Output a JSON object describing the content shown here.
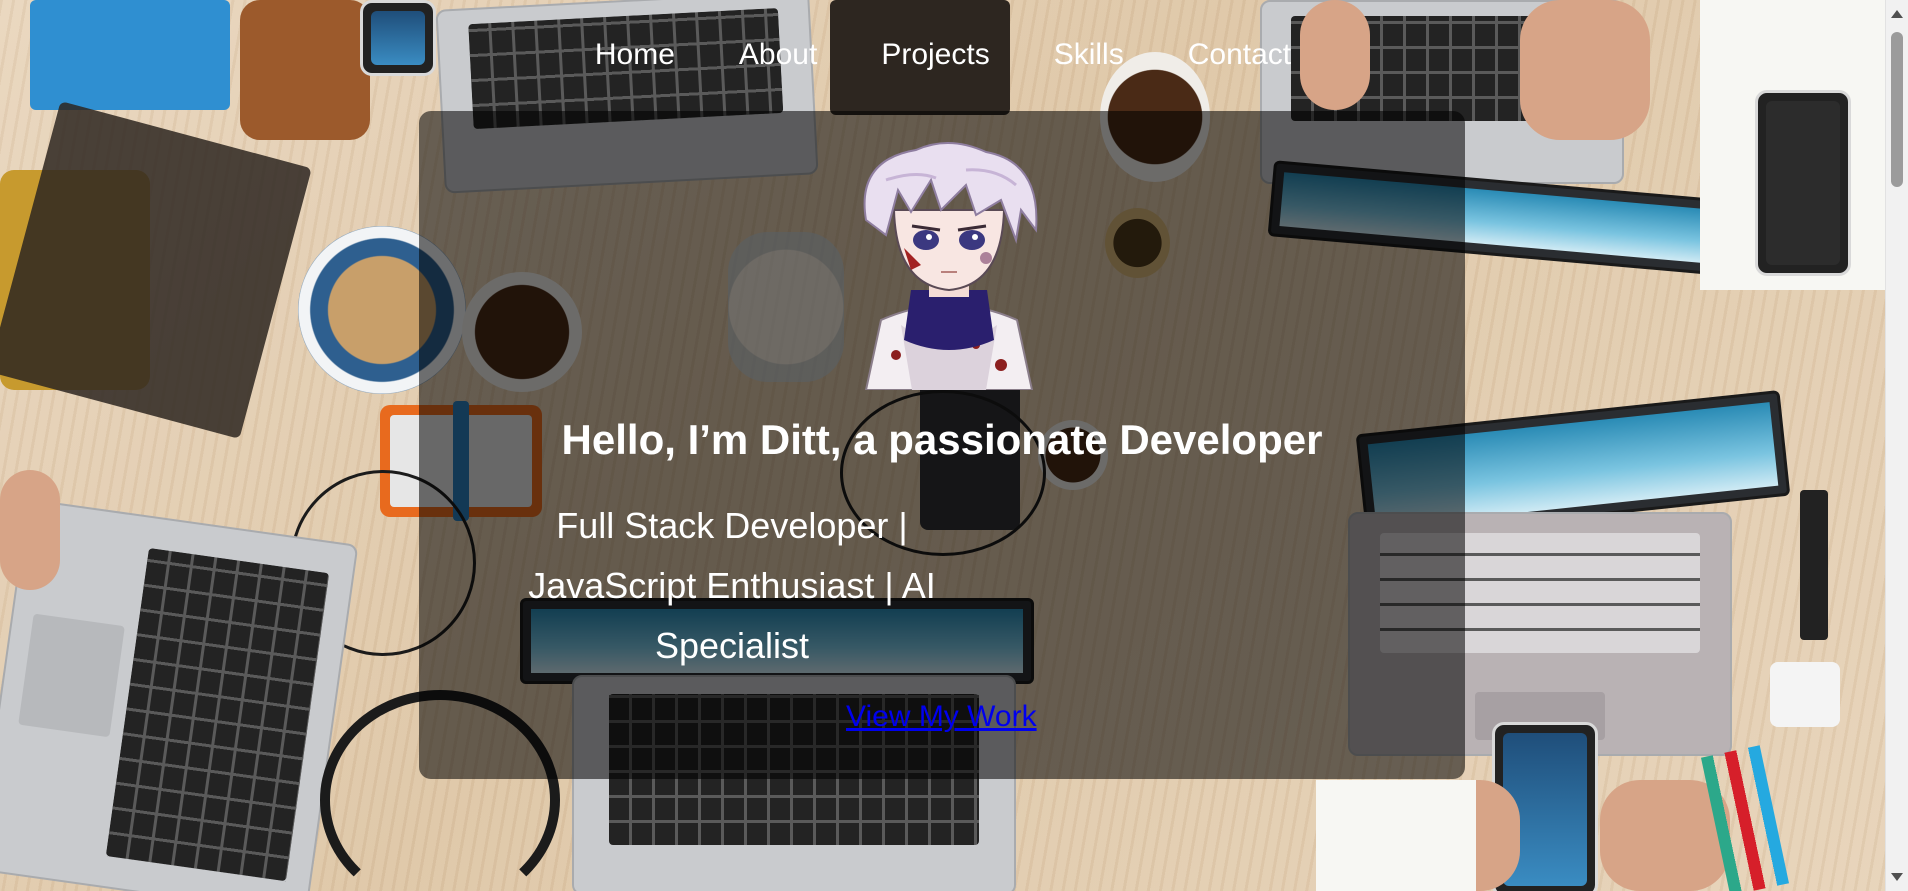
{
  "nav": {
    "items": [
      {
        "label": "Home"
      },
      {
        "label": "About"
      },
      {
        "label": "Projects"
      },
      {
        "label": "Skills"
      },
      {
        "label": "Contact"
      }
    ]
  },
  "hero": {
    "title": "Hello, I’m Ditt, a passionate Developer",
    "subtitle": "Full Stack Developer | JavaScript Enthusiast | AI Specialist",
    "cta_label": "View My Work",
    "avatar_icon": "anime-avatar-icon"
  },
  "colors": {
    "link": "#0000ee",
    "text": "#ffffff",
    "card_overlay": "rgba(0,0,0,0.55)"
  }
}
